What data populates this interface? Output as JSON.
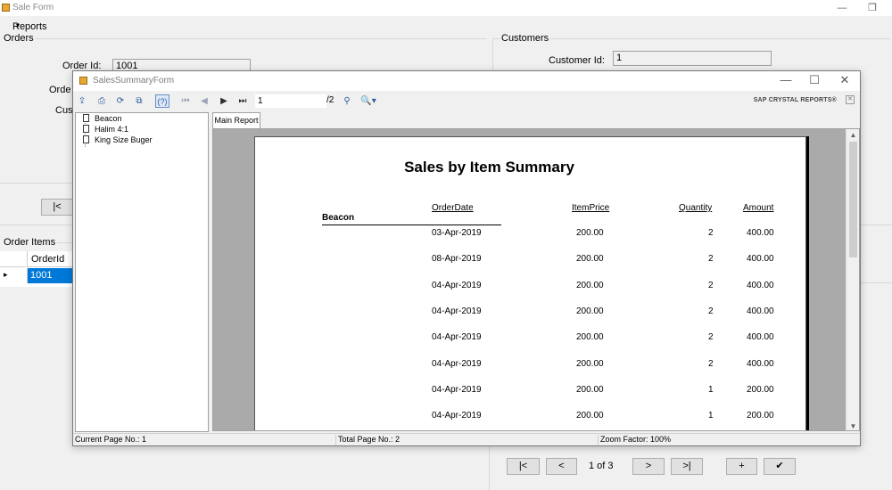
{
  "sale_form": {
    "title": "Sale Form",
    "menu": {
      "reports_label": "Reports",
      "reports_arrow": "▾"
    },
    "orders_group": "Orders",
    "order_id_label": "Order Id:",
    "order_id_value": "1001",
    "order_label_partial": "Orde",
    "cust_label_partial": "Cus",
    "customers_group": "Customers",
    "customer_id_label": "Customer Id:",
    "customer_id_value": "1",
    "first_button": "|<",
    "order_items_group": "Order Items",
    "grid": {
      "column": "OrderId",
      "row_marker": "▸",
      "selected_value": "1001"
    },
    "nav": {
      "first": "|<",
      "prev": "<",
      "page": "1 of 3",
      "next": ">",
      "last": ">|",
      "add": "+",
      "save_icon": "✔"
    }
  },
  "report_window": {
    "title": "SalesSummaryForm",
    "controls": {
      "minimize": "—",
      "maximize": "☐",
      "close": "✕"
    },
    "toolbar": {
      "icons": [
        "export-icon",
        "print-icon",
        "refresh-icon",
        "copy-icon",
        "group-tree-icon",
        "first-page-icon",
        "prev-page-icon",
        "next-page-icon",
        "last-page-icon",
        "find-icon",
        "zoom-icon"
      ],
      "page_value": "1",
      "page_total": "/2",
      "brand": "SAP CRYSTAL REPORTS®"
    },
    "tree": [
      "Beacon",
      "Halim 4:1",
      "King Size Buger"
    ],
    "tab": "Main Report",
    "report": {
      "title": "Sales by Item Summary",
      "columns": [
        "OrderDate",
        "ItemPrice",
        "Quantity",
        "Amount"
      ],
      "group": "Beacon",
      "rows": [
        [
          "03-Apr-2019",
          "200.00",
          "2",
          "400.00"
        ],
        [
          "08-Apr-2019",
          "200.00",
          "2",
          "400.00"
        ],
        [
          "04-Apr-2019",
          "200.00",
          "2",
          "400.00"
        ],
        [
          "04-Apr-2019",
          "200.00",
          "2",
          "400.00"
        ],
        [
          "04-Apr-2019",
          "200.00",
          "2",
          "400.00"
        ],
        [
          "04-Apr-2019",
          "200.00",
          "2",
          "400.00"
        ],
        [
          "04-Apr-2019",
          "200.00",
          "1",
          "200.00"
        ],
        [
          "04-Apr-2019",
          "200.00",
          "1",
          "200.00"
        ]
      ]
    },
    "status": {
      "current_page": "Current Page No.: 1",
      "total_page": "Total Page No.: 2",
      "zoom": "Zoom Factor: 100%"
    }
  }
}
